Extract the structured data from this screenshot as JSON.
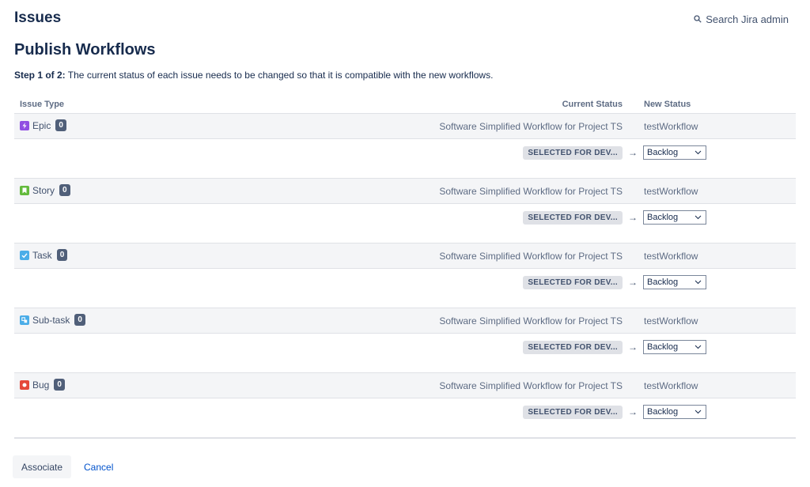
{
  "header": {
    "section_title": "Issues",
    "search_label": "Search Jira admin"
  },
  "page": {
    "title": "Publish Workflows",
    "step_label": "Step 1 of 2:",
    "step_text": " The current status of each issue needs to be changed so that it is compatible with the new workflows."
  },
  "table": {
    "col_issue_type": "Issue Type",
    "col_current_status": "Current Status",
    "col_new_status": "New Status",
    "rows": [
      {
        "type": "Epic",
        "icon": "epic-icon",
        "icon_color": "#904ee2",
        "count": "0",
        "from_workflow": "Software Simplified Workflow for Project TS",
        "to_workflow": "testWorkflow",
        "current_status": "SELECTED FOR DEV...",
        "new_status": "Backlog"
      },
      {
        "type": "Story",
        "icon": "story-icon",
        "icon_color": "#63ba3c",
        "count": "0",
        "from_workflow": "Software Simplified Workflow for Project TS",
        "to_workflow": "testWorkflow",
        "current_status": "SELECTED FOR DEV...",
        "new_status": "Backlog"
      },
      {
        "type": "Task",
        "icon": "task-icon",
        "icon_color": "#4bade8",
        "count": "0",
        "from_workflow": "Software Simplified Workflow for Project TS",
        "to_workflow": "testWorkflow",
        "current_status": "SELECTED FOR DEV...",
        "new_status": "Backlog"
      },
      {
        "type": "Sub-task",
        "icon": "subtask-icon",
        "icon_color": "#4bade8",
        "count": "0",
        "from_workflow": "Software Simplified Workflow for Project TS",
        "to_workflow": "testWorkflow",
        "current_status": "SELECTED FOR DEV...",
        "new_status": "Backlog"
      },
      {
        "type": "Bug",
        "icon": "bug-icon",
        "icon_color": "#e5493a",
        "count": "0",
        "from_workflow": "Software Simplified Workflow for Project TS",
        "to_workflow": "testWorkflow",
        "current_status": "SELECTED FOR DEV...",
        "new_status": "Backlog"
      }
    ]
  },
  "actions": {
    "associate_label": "Associate",
    "cancel_label": "Cancel"
  },
  "arrow_glyph": "→"
}
